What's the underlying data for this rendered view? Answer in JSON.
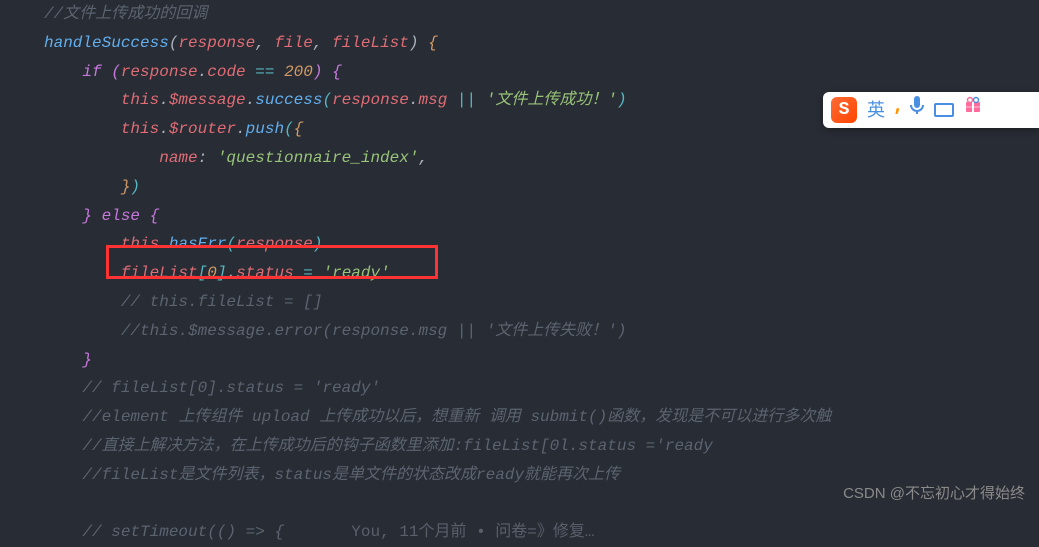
{
  "code": {
    "comment_top": "//文件上传成功的回调",
    "func_name": "handleSuccess",
    "param1": "response",
    "param2": "file",
    "param3": "fileList",
    "if_kw": "if",
    "response_var": "response",
    "code_prop": "code",
    "eq_op": "==",
    "num_200": "200",
    "this_kw": "this",
    "message_prop": "$message",
    "success_method": "success",
    "msg_prop": "msg",
    "or_op": "||",
    "upload_success_str": "'文件上传成功！'",
    "router_prop": "$router",
    "push_method": "push",
    "name_key": "name",
    "route_name_str": "'questionnaire_index'",
    "else_kw": "else",
    "hasErr_method": "hasErr",
    "fileList_var": "fileList",
    "zero": "0",
    "status_prop": "status",
    "ready_str": "'ready'",
    "comment_filelist_empty": "// this.fileList = []",
    "comment_error_msg": "//this.$message.error(response.msg || '文件上传失败！')",
    "comment_status_ready": "// fileList[0].status = 'ready'",
    "comment_element": "//element 上传组件 upload 上传成功以后，想重新 调用 submit()函数，发现是不可以进行多次触",
    "comment_solution": "//直接上解决方法，在上传成功后的钩子函数里添加:fileList[0l.status ='ready",
    "comment_filelist_desc": "//fileList是文件列表，status是单文件的状态改成ready就能再次上传",
    "setTimeout_comment": "// setTimeout(() => {",
    "blame_text": "You, 11个月前 • 问卷=》修复…"
  },
  "ime": {
    "logo": "S",
    "lang": "英",
    "comma": "⸴",
    "mic": "🎤",
    "gift": "🎁"
  },
  "watermark": "CSDN @不忘初心才得始终"
}
